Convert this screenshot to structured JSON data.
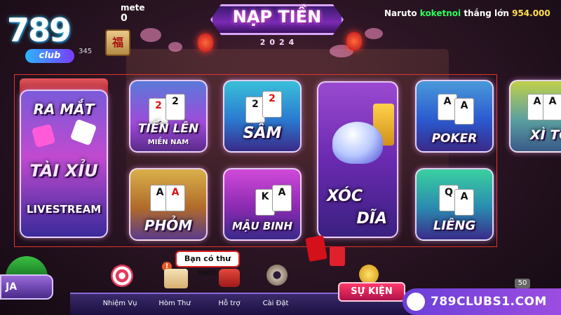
{
  "header": {
    "logo_text": "789",
    "logo_sub": "club",
    "user_name": "mete",
    "user_balance": "0",
    "user_id_partial": "345",
    "banner_title": "NẠP TIỀN",
    "banner_year": "2024"
  },
  "ticker": {
    "player": "Naruto",
    "game": "koketnoi",
    "message": "thắng lớn",
    "amount": "954.000"
  },
  "games": [
    {
      "name": "taixiu",
      "line1": "RA MẮT",
      "line2": "TÀI XỈU",
      "line3": "LIVESTREAM"
    },
    {
      "name": "tienlen",
      "title": "TIẾN LÊN",
      "sub": "MIỀN NAM"
    },
    {
      "name": "sam",
      "title": "SÂM"
    },
    {
      "name": "xocdia",
      "line1": "XÓC",
      "line2": "DĨA"
    },
    {
      "name": "poker",
      "title": "POKER"
    },
    {
      "name": "xito",
      "title": "XÌ TỐ"
    },
    {
      "name": "phom",
      "title": "PHỎM"
    },
    {
      "name": "maubinh",
      "title": "MẬU BINH"
    },
    {
      "name": "lieng",
      "title": "LIÊNG"
    }
  ],
  "bottom_nav": [
    {
      "label": "Nhiệm Vụ"
    },
    {
      "label": "Hòm Thư"
    },
    {
      "label": "Hỗ trợ"
    },
    {
      "label": "Cài Đặt"
    }
  ],
  "tooltip": "Bạn có thư mới!",
  "notification": "!",
  "jackpot_label": "JA",
  "event_button": "SỰ KIỆN",
  "badge": "50",
  "watermark": "789CLUBS1.COM",
  "colors": {
    "frame": "#e3342b",
    "ticker_game": "#2cff5a",
    "ticker_amount": "#ffe04a",
    "watermark_bg": "#7a45dc"
  }
}
